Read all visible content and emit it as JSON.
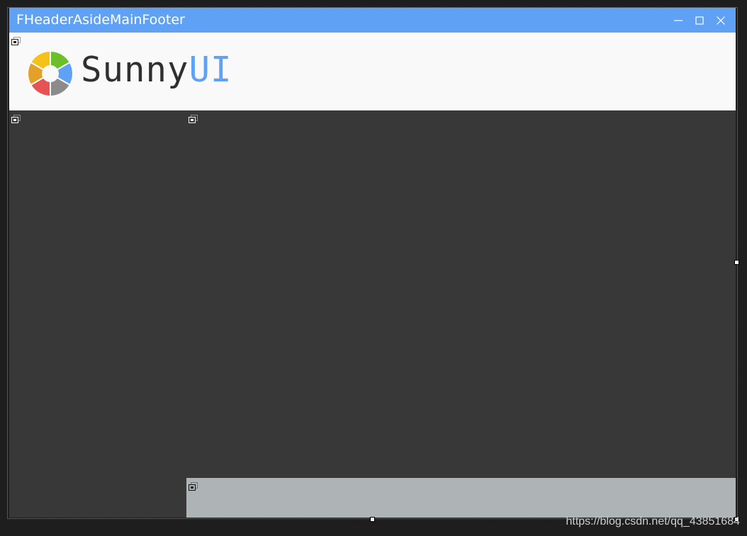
{
  "window": {
    "title": "FHeaderAsideMainFooter",
    "colors": {
      "titlebar": "#5fa2f5",
      "header": "#f9f9f9",
      "aside": "#383838",
      "main": "#383838",
      "footer": "#aeb3b5"
    }
  },
  "title_buttons": [
    "minimize-icon",
    "maximize-icon",
    "close-icon"
  ],
  "logo": {
    "text_main": "Sunny",
    "text_accent": "UI",
    "segment_colors": [
      "#6cbf2a",
      "#5fa2f5",
      "#8b8b8b",
      "#e55353",
      "#e4a12a",
      "#f6c21a"
    ]
  },
  "designer_glyph": "panel-glyph-icon",
  "watermark": "https://blog.csdn.net/qq_43851684"
}
